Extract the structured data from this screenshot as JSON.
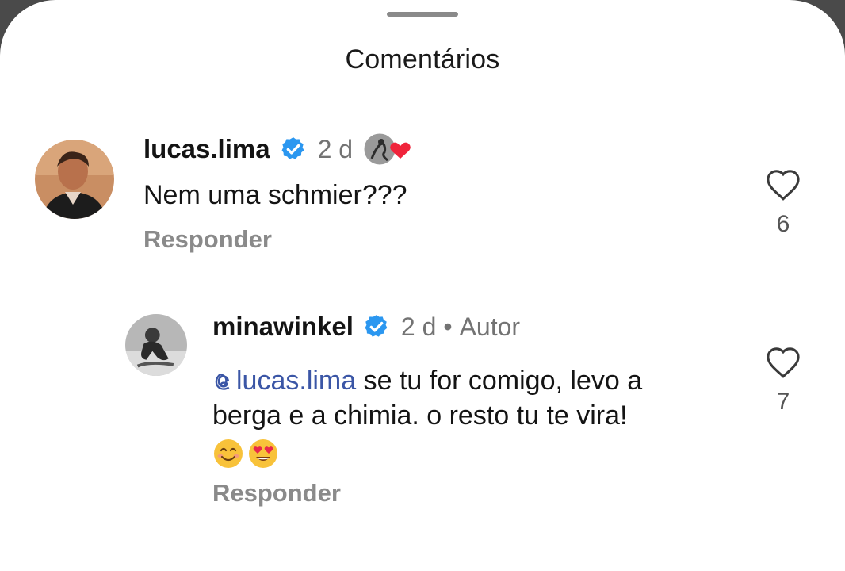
{
  "sheet": {
    "title": "Comentários"
  },
  "comments": [
    {
      "username": "lucas.lima",
      "time": "2 d",
      "text": "Nem uma schmier???",
      "reply_label": "Responder",
      "likes": "6"
    },
    {
      "username": "minawinkel",
      "time": "2 d",
      "separator": "•",
      "author_label": "Autor",
      "mention": "lucas.lima",
      "text_line1": " se tu for comigo, levo a",
      "text_line2": "berga e a chimia. o resto tu te vira!",
      "emojis": [
        "smiling-face-emoji",
        "heart-eyes-emoji"
      ],
      "reply_label": "Responder",
      "likes": "7"
    }
  ],
  "colors": {
    "verified": "#2b97f0",
    "heart_badge": "#f0243b",
    "mention": "#3b56a6",
    "meta_gray": "#737373"
  }
}
